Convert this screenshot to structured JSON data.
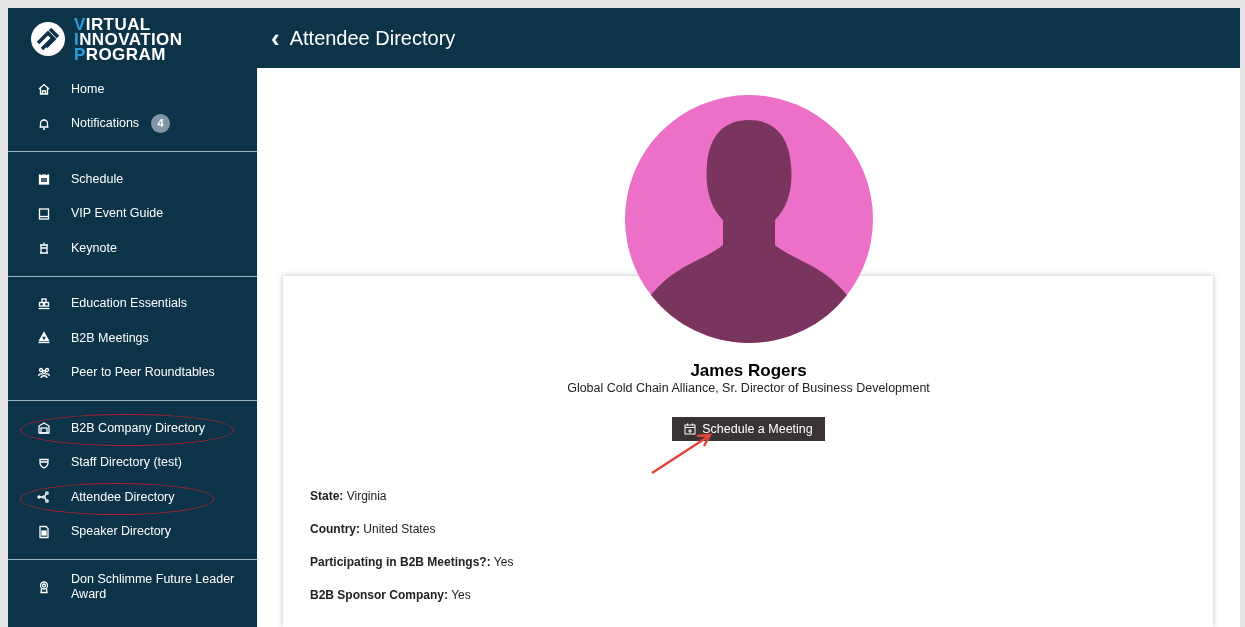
{
  "logo": {
    "lines": [
      "VIRTUAL",
      "INNOVATION",
      "PROGRAM"
    ]
  },
  "sidebar": {
    "groups": [
      {
        "items": [
          {
            "label": "Home",
            "circled": false
          },
          {
            "label": "Notifications",
            "badge": "4",
            "circled": false
          }
        ]
      },
      {
        "items": [
          {
            "label": "Schedule",
            "circled": false
          },
          {
            "label": "VIP Event Guide",
            "circled": false
          },
          {
            "label": "Keynote",
            "circled": false
          }
        ]
      },
      {
        "items": [
          {
            "label": "Education Essentials",
            "circled": false
          },
          {
            "label": "B2B Meetings",
            "circled": false
          },
          {
            "label": "Peer to Peer Roundtables",
            "circled": false
          }
        ]
      },
      {
        "items": [
          {
            "label": "B2B Company Directory",
            "circled": true
          },
          {
            "label": "Staff Directory (test)",
            "circled": false
          },
          {
            "label": "Attendee Directory",
            "circled": true
          },
          {
            "label": "Speaker Directory",
            "circled": false
          }
        ]
      },
      {
        "items": [
          {
            "label": "Don Schlimme Future Leader Award",
            "circled": false
          }
        ]
      }
    ]
  },
  "header": {
    "back": "‹",
    "title": "Attendee Directory"
  },
  "profile": {
    "name": "James Rogers",
    "subtitle": "Global Cold Chain Alliance, Sr. Director of Business Development",
    "button": {
      "label": "Schedule a Meeting",
      "pointed_at": true
    },
    "fields": [
      {
        "label": "State:",
        "value": "Virginia"
      },
      {
        "label": "Country:",
        "value": "United States"
      },
      {
        "label": "Participating in B2B Meetings?:",
        "value": "Yes"
      },
      {
        "label": "B2B Sponsor Company:",
        "value": "Yes"
      }
    ]
  }
}
